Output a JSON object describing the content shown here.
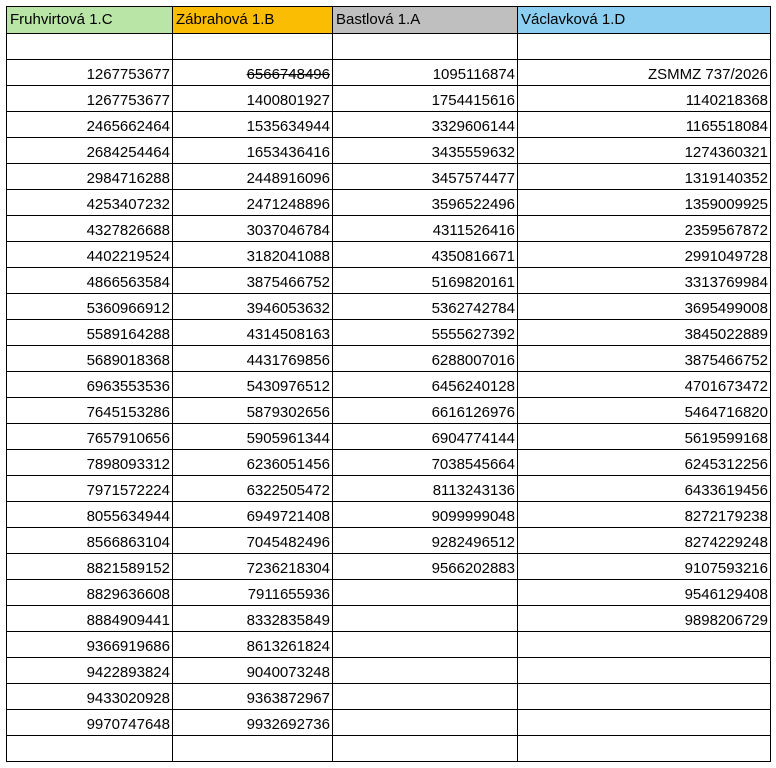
{
  "columns": [
    {
      "name": "Fruhvirtová 1.C",
      "color": "#b9e5a6"
    },
    {
      "name": "Zábrahová 1.B",
      "color": "#fbbd04"
    },
    {
      "name": "Bastlová 1.A",
      "color": "#bfbfbf"
    },
    {
      "name": "Václavková 1.D",
      "color": "#8dcff0"
    }
  ],
  "rows": [
    [
      "1267753677",
      "6566748496",
      "1095116874",
      "ZSMMZ 737/2026"
    ],
    [
      "1267753677",
      "1400801927",
      "1754415616",
      "1140218368"
    ],
    [
      "2465662464",
      "1535634944",
      "3329606144",
      "1165518084"
    ],
    [
      "2684254464",
      "1653436416",
      "3435559632",
      "1274360321"
    ],
    [
      "2984716288",
      "2448916096",
      "3457574477",
      "1319140352"
    ],
    [
      "4253407232",
      "2471248896",
      "3596522496",
      "1359009925"
    ],
    [
      "4327826688",
      "3037046784",
      "4311526416",
      "2359567872"
    ],
    [
      "4402219524",
      "3182041088",
      "4350816671",
      "2991049728"
    ],
    [
      "4866563584",
      "3875466752",
      "5169820161",
      "3313769984"
    ],
    [
      "5360966912",
      "3946053632",
      "5362742784",
      "3695499008"
    ],
    [
      "5589164288",
      "4314508163",
      "5555627392",
      "3845022889"
    ],
    [
      "5689018368",
      "4431769856",
      "6288007016",
      "3875466752"
    ],
    [
      "6963553536",
      "5430976512",
      "6456240128",
      "4701673472"
    ],
    [
      "7645153286",
      "5879302656",
      "6616126976",
      "5464716820"
    ],
    [
      "7657910656",
      "5905961344",
      "6904774144",
      "5619599168"
    ],
    [
      "7898093312",
      "6236051456",
      "7038545664",
      "6245312256"
    ],
    [
      "7971572224",
      "6322505472",
      "8113243136",
      "6433619456"
    ],
    [
      "8055634944",
      "6949721408",
      "9099999048",
      "8272179238"
    ],
    [
      "8566863104",
      "7045482496",
      "9282496512",
      "8274229248"
    ],
    [
      "8821589152",
      "7236218304",
      "9566202883",
      "9107593216"
    ],
    [
      "8829636608",
      "7911655936",
      "",
      "9546129408"
    ],
    [
      "8884909441",
      "8332835849",
      "",
      "9898206729"
    ],
    [
      "9366919686",
      "8613261824",
      "",
      ""
    ],
    [
      "9422893824",
      "9040073248",
      "",
      ""
    ],
    [
      "9433020928",
      "9363872967",
      "",
      ""
    ],
    [
      "9970747648",
      "9932692736",
      "",
      ""
    ],
    [
      "",
      "",
      "",
      ""
    ]
  ],
  "struck_cells": [
    {
      "row": 0,
      "col": 1
    }
  ]
}
